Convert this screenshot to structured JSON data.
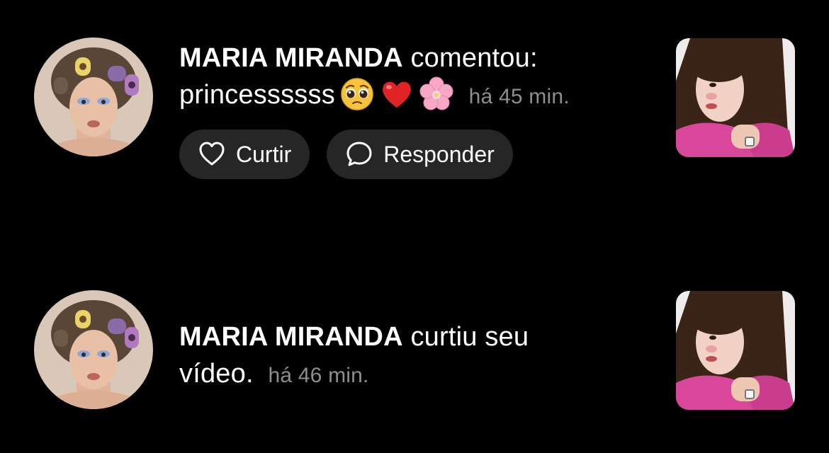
{
  "notifications": [
    {
      "username": "MARIA MIRANDA",
      "action": "comentou:",
      "comment": "princessssss",
      "emojis": [
        "pleading-face-emoji",
        "red-heart-emoji",
        "cherry-blossom-emoji"
      ],
      "time": "há 45 min.",
      "buttons": {
        "like_label": "Curtir",
        "reply_label": "Responder"
      }
    },
    {
      "username": "MARIA MIRANDA",
      "action": "curtiu seu",
      "action_line2": "vídeo.",
      "time": "há 46 min."
    }
  ],
  "colors": {
    "background": "#000000",
    "text": "#ffffff",
    "muted": "#8e8e8e",
    "pill": "#262626"
  }
}
